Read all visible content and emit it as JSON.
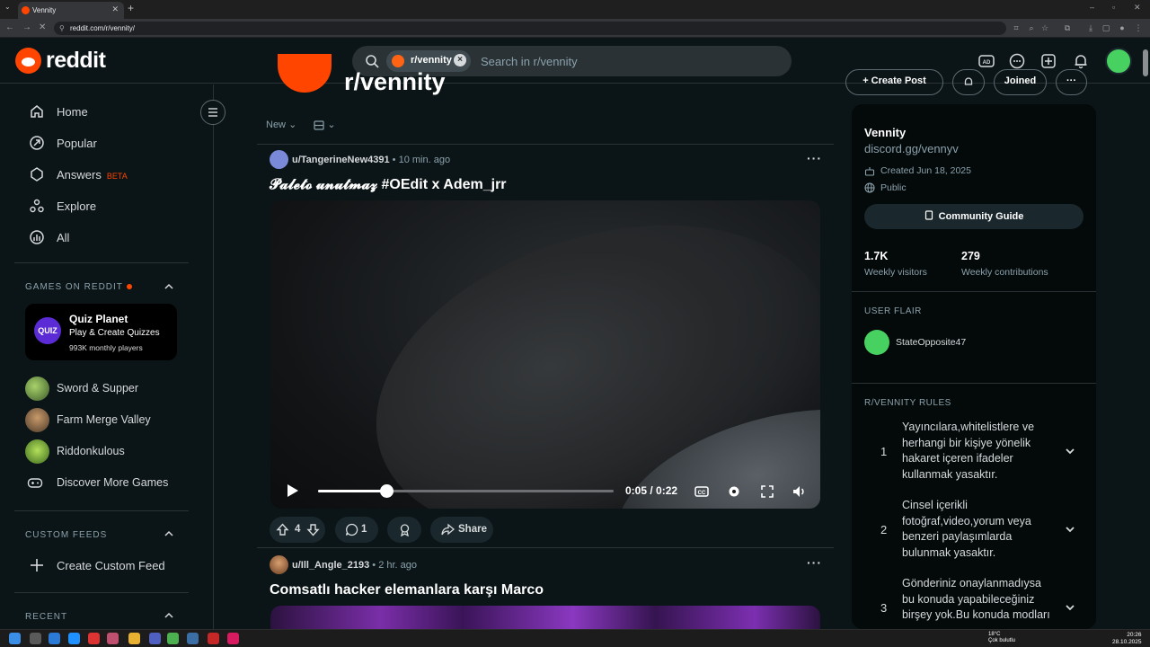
{
  "browser": {
    "tab_title": "Vennity",
    "url": "reddit.com/r/vennity/"
  },
  "header": {
    "logo_text": "reddit",
    "search_chip": "r/vennity",
    "search_placeholder": "Search in r/vennity",
    "icons": [
      "advertise-icon",
      "chat-icon",
      "create-post-icon",
      "notifications-icon",
      "user-avatar"
    ]
  },
  "sidebar": {
    "nav": [
      {
        "label": "Home",
        "icon": "home-icon"
      },
      {
        "label": "Popular",
        "icon": "popular-icon"
      },
      {
        "label": "Answers",
        "icon": "answers-icon",
        "badge": "BETA"
      },
      {
        "label": "Explore",
        "icon": "explore-icon"
      },
      {
        "label": "All",
        "icon": "all-icon"
      }
    ],
    "games_section": "GAMES ON REDDIT",
    "featured_game": {
      "icon_text": "QUIZ",
      "title": "Quiz Planet",
      "subtitle": "Play & Create Quizzes",
      "players": "993K monthly players"
    },
    "games": [
      {
        "label": "Sword & Supper"
      },
      {
        "label": "Farm Merge Valley"
      },
      {
        "label": "Riddonkulous"
      },
      {
        "label": "Discover More Games"
      }
    ],
    "custom_feeds_section": "CUSTOM FEEDS",
    "create_custom_feed": "Create Custom Feed",
    "recent_section": "RECENT"
  },
  "subreddit": {
    "name": "r/vennity",
    "create_post": "Create Post",
    "joined": "Joined"
  },
  "sortbar": {
    "sort": "New"
  },
  "posts": [
    {
      "author": "u/TangerineNew4391",
      "time": "10 min. ago",
      "title": "𝓟𝓪𝓵𝓮𝓽𝓸 𝓾𝓷𝓾𝓽𝓶𝓪𝔃 #OEdit x Adem_jrr",
      "video": {
        "current": "0:05",
        "duration": "0:22",
        "progress": 0.23,
        "time_display": "0:05 / 0:22"
      },
      "votes": "4",
      "comments": "1",
      "share": "Share"
    },
    {
      "author": "u/Ill_Angle_2193",
      "time": "2 hr. ago",
      "title": "Comsatlı hacker elemanlara karşı Marco"
    }
  ],
  "community": {
    "title": "Vennity",
    "link": "discord.gg/vennyv",
    "created": "Created Jun 18, 2025",
    "visibility": "Public",
    "guide_button": "Community Guide",
    "stats": [
      {
        "value": "1.7K",
        "label": "Weekly visitors"
      },
      {
        "value": "279",
        "label": "Weekly contributions"
      }
    ],
    "user_flair_heading": "USER FLAIR",
    "flair_user": "StateOpposite47",
    "rules_heading": "R/VENNITY RULES",
    "rules": [
      {
        "num": "1",
        "text": "Yayıncılara,whitelistlere ve herhangi bir kişiye yönelik hakaret içeren ifadeler kullanmak yasaktır."
      },
      {
        "num": "2",
        "text": "Cinsel içerikli fotoğraf,video,yorum veya benzeri paylaşımlarda bulunmak yasaktır."
      },
      {
        "num": "3",
        "text": "Gönderiniz onaylanmadıysa bu konuda yapabileceğiniz birşey yok.Bu konuda modları"
      }
    ]
  },
  "taskbar": {
    "weather_temp": "18°C",
    "weather_desc": "Çok bulutlu",
    "time": "20:26",
    "date": "28.10.2025"
  },
  "colors": {
    "background": "#0b1416",
    "accent": "#ff4500",
    "panel": "#04090a",
    "muted": "#8ba2ad"
  }
}
